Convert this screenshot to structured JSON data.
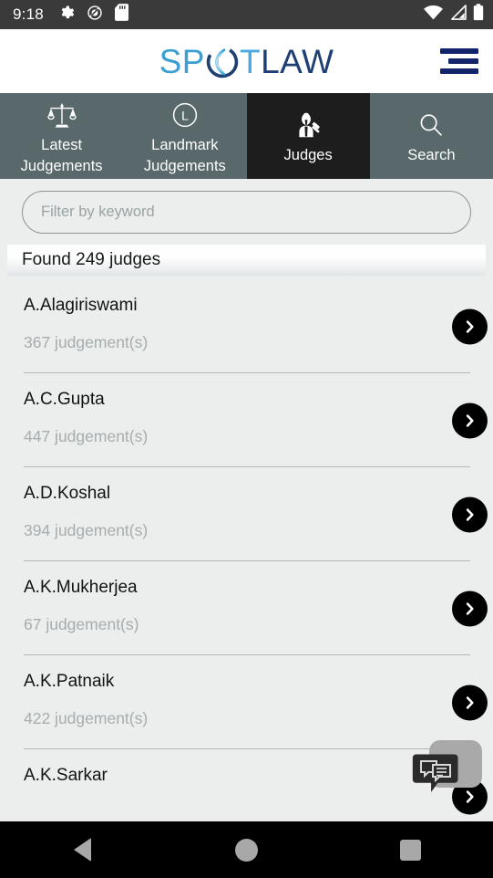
{
  "status_bar": {
    "time": "9:18",
    "left_icons": [
      "gear-icon",
      "do-not-disturb-icon",
      "sd-card-icon"
    ],
    "right_icons": [
      "wifi-icon",
      "cell-signal-icon",
      "battery-icon"
    ]
  },
  "header": {
    "logo_sp": "SP",
    "logo_o": "O",
    "logo_t": "T",
    "logo_law": "LAW",
    "menu_icon": "hamburger-menu-icon"
  },
  "tabs": [
    {
      "label_line1": "Latest",
      "label_line2": "Judgements",
      "icon": "scales-of-justice-icon",
      "active": false
    },
    {
      "label_line1": "Landmark",
      "label_line2": "Judgements",
      "icon": "landmark-circle-l-icon",
      "active": false
    },
    {
      "label_line1": "Judges",
      "label_line2": "",
      "icon": "judge-gavel-icon",
      "active": true
    },
    {
      "label_line1": "Search",
      "label_line2": "",
      "icon": "magnifier-icon",
      "active": false
    }
  ],
  "filter": {
    "placeholder": "Filter by keyword",
    "value": ""
  },
  "results": {
    "found_label": "Found 249 judges",
    "count": 249
  },
  "judges": [
    {
      "name": "A.Alagiriswami",
      "judgements": "367 judgement(s)"
    },
    {
      "name": "A.C.Gupta",
      "judgements": "447 judgement(s)"
    },
    {
      "name": "A.D.Koshal",
      "judgements": "394 judgement(s)"
    },
    {
      "name": "A.K.Mukherjea",
      "judgements": "67 judgement(s)"
    },
    {
      "name": "A.K.Patnaik",
      "judgements": "422 judgement(s)"
    },
    {
      "name": "A.K.Sarkar",
      "judgements": ""
    }
  ],
  "fab": {
    "icon": "chat-bubbles-icon"
  },
  "nav_bar": {
    "back": "back-triangle-icon",
    "home": "home-circle-icon",
    "recents": "recents-square-icon"
  },
  "colors": {
    "tab_bar": "#58686b",
    "tab_active": "#1d1d1d",
    "page_bg": "#eceded",
    "logo_blue_light": "#3b9fd4",
    "logo_blue_dark": "#1d3f73",
    "menu_navy": "#13246b",
    "status_bar": "#3a3a3a",
    "nav_bar": "#000000"
  }
}
